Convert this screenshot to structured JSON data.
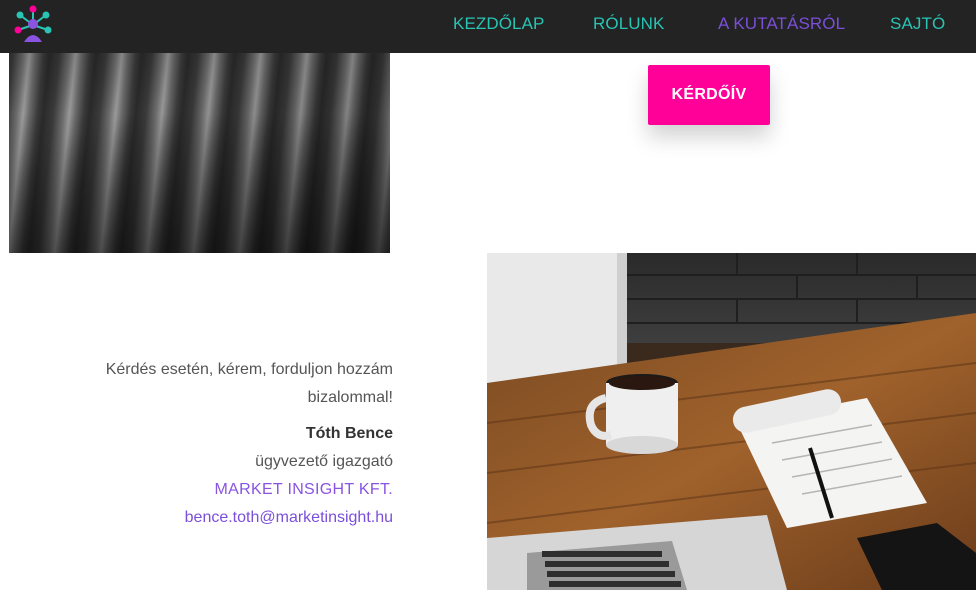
{
  "nav": {
    "logo_icon": "network-people-logo-icon",
    "items": [
      {
        "label": "KEZDŐLAP",
        "active": false
      },
      {
        "label": "RÓLUNK",
        "active": false
      },
      {
        "label": "A KUTATÁSRÓL",
        "active": true
      },
      {
        "label": "SAJTÓ",
        "active": false
      }
    ]
  },
  "cta": {
    "label": "KÉRDŐÍV"
  },
  "contact": {
    "intro": "Kérdés esetén, kérem, forduljon hozzám bizalommal!",
    "name": "Tóth Bence",
    "role": "ügyvezető igazgató",
    "company": "MARKET INSIGHT KFT.",
    "email": "bence.toth@marketinsight.hu"
  },
  "colors": {
    "nav_bg": "#232323",
    "nav_link": "#29c4b4",
    "nav_active": "#7b4fd9",
    "cta_bg": "#ff0099",
    "accent_purple": "#8a54e0"
  }
}
